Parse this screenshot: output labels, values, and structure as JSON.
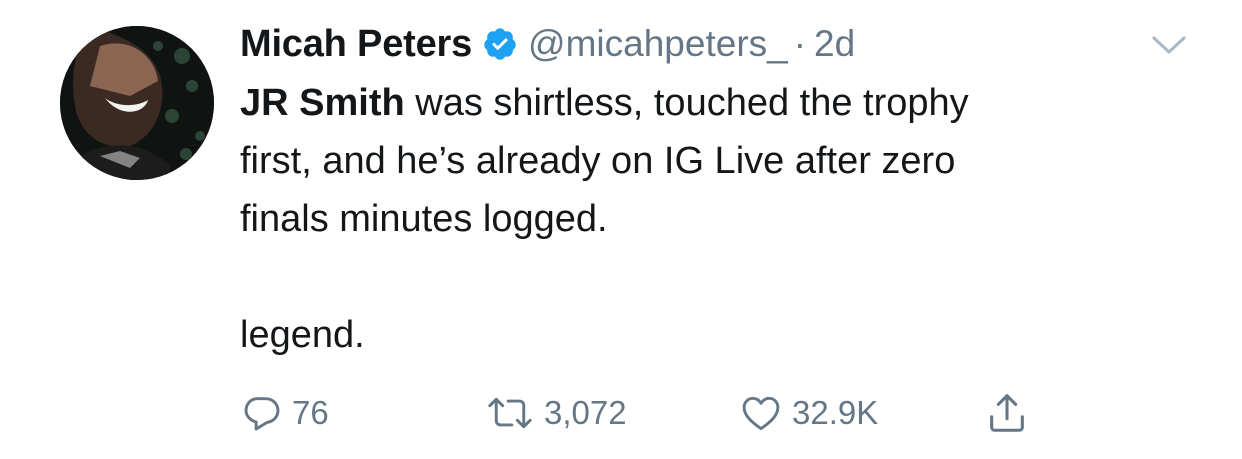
{
  "tweet": {
    "author": {
      "display_name": "Micah Peters",
      "handle": "@micahpeters_",
      "verified": true,
      "avatar_icon": "person-covering-face-avatar"
    },
    "separator": "·",
    "timestamp": "2d",
    "text": {
      "mention": "JR Smith",
      "line1_rest": " was shirtless, touched the trophy",
      "line2": "first, and he’s already on IG Live after zero",
      "line3": "finals minutes logged.",
      "line4": "legend."
    },
    "actions": {
      "reply_count": "76",
      "retweet_count": "3,072",
      "like_count": "32.9K"
    }
  },
  "icons": {
    "verified": "verified-badge-icon",
    "menu": "chevron-down-icon",
    "reply": "reply-icon",
    "retweet": "retweet-icon",
    "like": "heart-icon",
    "share": "share-icon"
  },
  "colors": {
    "text_primary": "#14171a",
    "text_secondary": "#657786",
    "verified_blue": "#1da1f2",
    "chevron": "#aab8c2"
  }
}
